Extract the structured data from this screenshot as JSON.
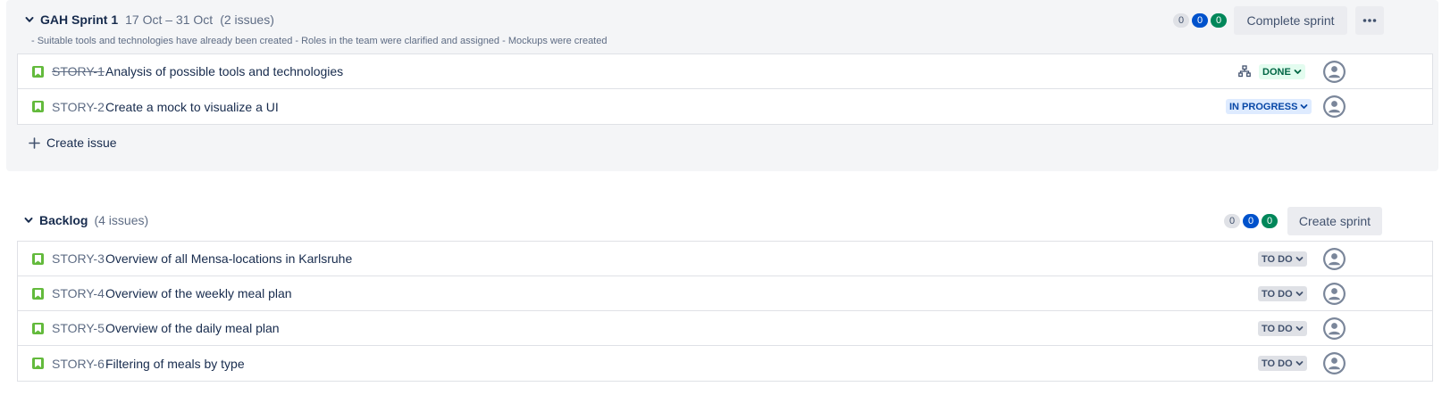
{
  "sprint": {
    "name": "GAH Sprint 1",
    "dates": "17 Oct – 31 Oct",
    "issue_count": "(2 issues)",
    "goal": "- Suitable tools and technologies have already been created - Roles in the team were clarified and assigned - Mockups were created",
    "counters": {
      "todo": "0",
      "in_progress": "0",
      "done": "0"
    },
    "complete_label": "Complete sprint",
    "issues": [
      {
        "key": "STORY-1",
        "summary": "Analysis of possible tools and technologies",
        "status": "DONE"
      },
      {
        "key": "STORY-2",
        "summary": "Create a mock to visualize a UI",
        "status": "IN PROGRESS"
      }
    ],
    "create_issue_label": "Create issue"
  },
  "backlog": {
    "name": "Backlog",
    "issue_count": "(4 issues)",
    "counters": {
      "todo": "0",
      "in_progress": "0",
      "done": "0"
    },
    "create_sprint_label": "Create sprint",
    "issues": [
      {
        "key": "STORY-3",
        "summary": "Overview of all Mensa-locations in Karlsruhe",
        "status": "TO DO"
      },
      {
        "key": "STORY-4",
        "summary": "Overview of the weekly meal plan",
        "status": "TO DO"
      },
      {
        "key": "STORY-5",
        "summary": "Overview of the daily meal plan",
        "status": "TO DO"
      },
      {
        "key": "STORY-6",
        "summary": "Filtering of meals by type",
        "status": "TO DO"
      }
    ]
  },
  "icons": {
    "story": "story-bookmark-icon",
    "child_issues": "child-issues-icon",
    "avatar": "unassigned-avatar-icon",
    "chevron": "chevron-down-icon",
    "more": "more-horizontal-icon",
    "add": "plus-icon"
  },
  "colors": {
    "story_green": "#63ba3c",
    "done_bg": "#e3fcef",
    "done_text": "#006644",
    "inprogress_bg": "#deebff",
    "inprogress_text": "#0747a6",
    "todo_bg": "#dfe1e6",
    "panel_bg": "#f4f5f7",
    "counter_blue": "#0052cc",
    "counter_green": "#00875a"
  }
}
